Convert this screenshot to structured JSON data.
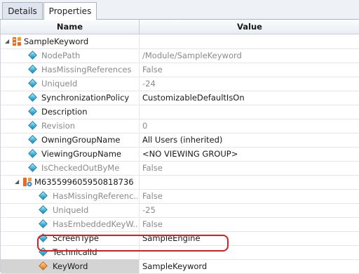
{
  "tabs": [
    "Details",
    "Properties"
  ],
  "header": {
    "name": "Name",
    "value": "Value"
  },
  "root": {
    "name": "SampleKeyword"
  },
  "rows": [
    {
      "name": "NodePath",
      "value": "/Module/SampleKeyword",
      "readonly": true,
      "icon": "diamond-icon"
    },
    {
      "name": "HasMissingReferences",
      "value": "False",
      "readonly": true,
      "icon": "diamond-icon"
    },
    {
      "name": "UniqueId",
      "value": "-24",
      "readonly": true,
      "icon": "diamond-icon"
    },
    {
      "name": "SynchronizationPolicy",
      "value": "CustomizableDefaultIsOn",
      "readonly": false,
      "icon": "diamond-icon"
    },
    {
      "name": "Description",
      "value": "",
      "readonly": false,
      "icon": "diamond-icon"
    },
    {
      "name": "Revision",
      "value": "0",
      "readonly": true,
      "icon": "diamond-icon"
    },
    {
      "name": "OwningGroupName",
      "value": "All Users (inherited)",
      "readonly": false,
      "icon": "diamond-icon"
    },
    {
      "name": "ViewingGroupName",
      "value": "<NO VIEWING GROUP>",
      "readonly": false,
      "icon": "diamond-icon"
    },
    {
      "name": "IsCheckedOutByMe",
      "value": "False",
      "readonly": true,
      "icon": "diamond-icon"
    }
  ],
  "child": {
    "name": "M635599605950818736"
  },
  "child_rows": [
    {
      "name": "HasMissingReferenc...",
      "value": "False",
      "readonly": true,
      "icon": "diamond-icon"
    },
    {
      "name": "UniqueId",
      "value": "-25",
      "readonly": true,
      "icon": "diamond-icon"
    },
    {
      "name": "HasEmbeddedKeyW...",
      "value": "False",
      "readonly": true,
      "icon": "diamond-icon"
    },
    {
      "name": "ScreenType",
      "value": "SampleEngine",
      "readonly": false,
      "icon": "diamond-icon"
    },
    {
      "name": "TechnicalId",
      "value": "",
      "readonly": false,
      "icon": "diamond-icon"
    },
    {
      "name": "KeyWord",
      "value": "SampleKeyword",
      "readonly": false,
      "icon": "orange-diamond-icon",
      "selected": true
    }
  ]
}
